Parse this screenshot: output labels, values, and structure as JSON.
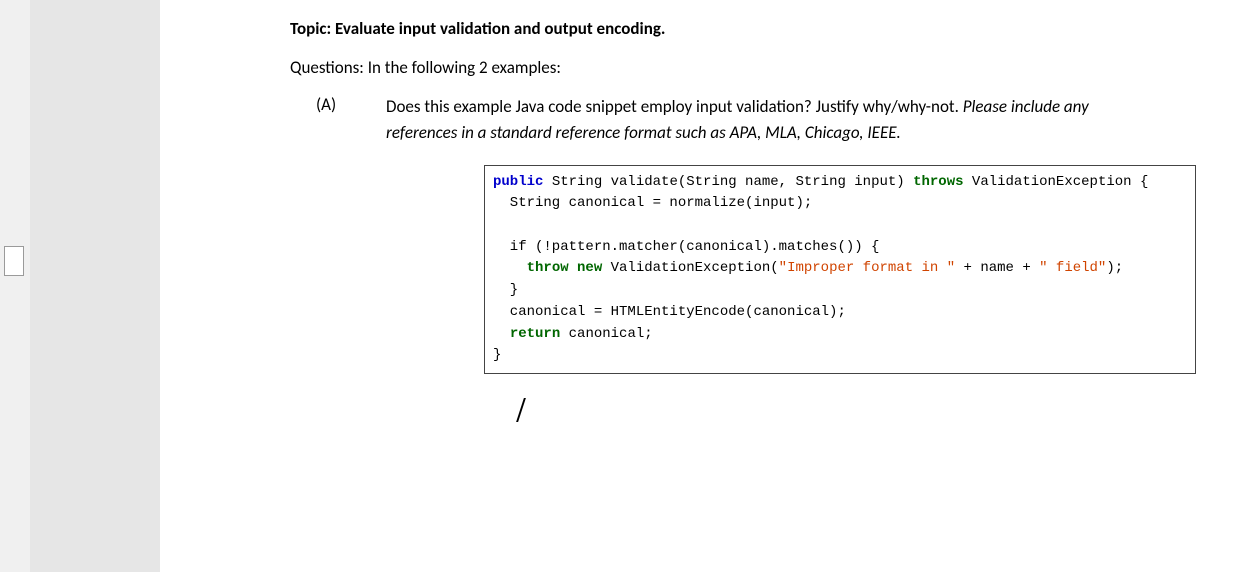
{
  "topic": {
    "label": "Topic: ",
    "text": "Evaluate input validation and output encoding."
  },
  "questions_prefix": "Questions: In the following 2 examples:",
  "item_a": {
    "marker": "(A)",
    "text_main": "Does this example Java code snippet employ input validation? Justify why/why-not. ",
    "text_italic": "Please include any references in a standard reference format such as APA, MLA, Chicago, IEEE."
  },
  "code": {
    "kw_public": "public",
    "sig_rest": " String validate(String name, String input) ",
    "kw_throws": "throws",
    "sig_tail": " ValidationException {",
    "line2": "  String canonical = normalize(input);",
    "blank": "",
    "line_if": "  if (!pattern.matcher(canonical).matches()) {",
    "line_throw_pre": "    ",
    "kw_throw": "throw",
    "kw_new": " new",
    "line_throw_mid": " ValidationException(",
    "str1": "\"Improper format in \"",
    "line_throw_mid2": " + name + ",
    "str2": "\" field\"",
    "line_throw_end": ");",
    "line_close_if": "  }",
    "line_enc": "  canonical = HTMLEntityEncode(canonical);",
    "line_ret_pre": "  ",
    "kw_return": "return",
    "line_ret_post": " canonical;",
    "line_close": "}"
  }
}
